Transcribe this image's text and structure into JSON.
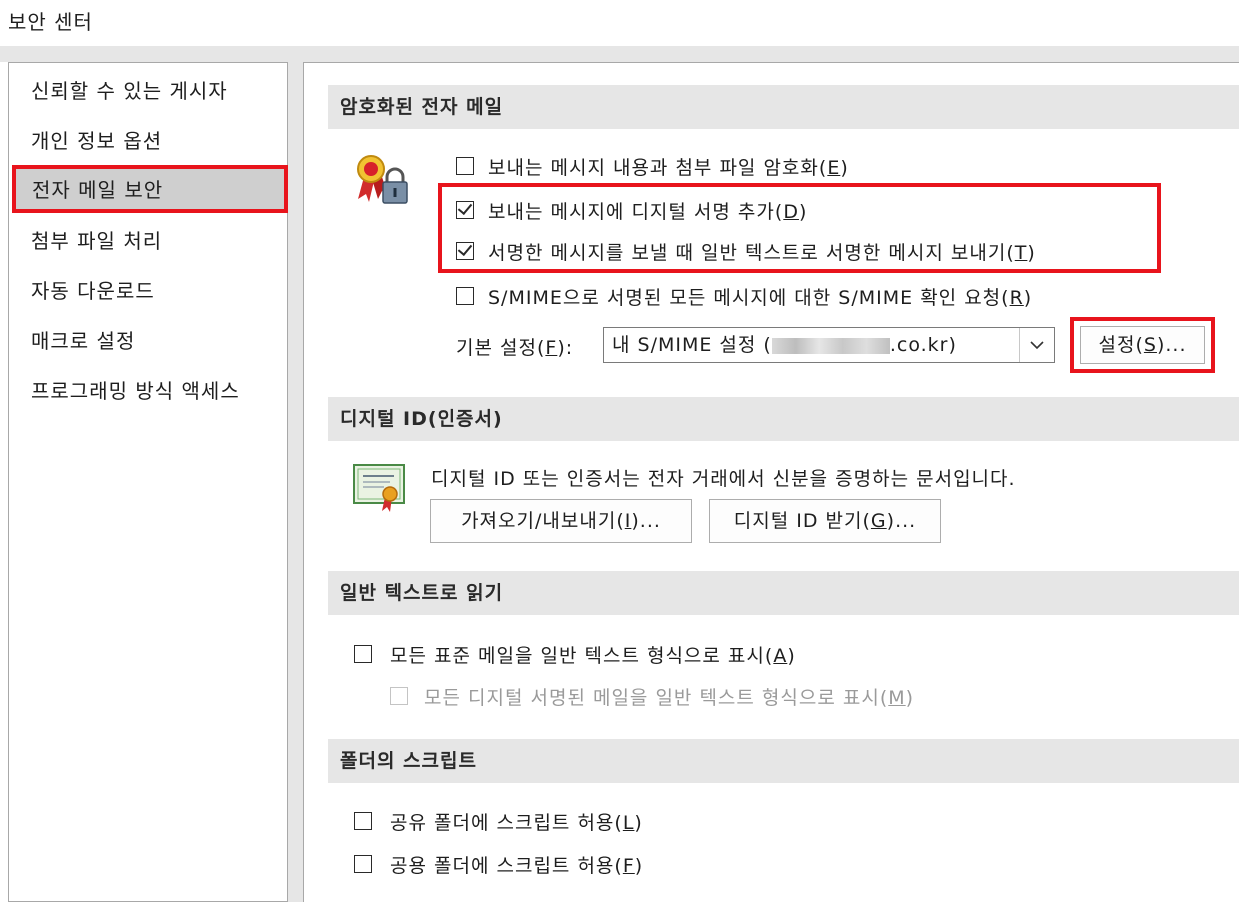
{
  "window": {
    "title": "보안 센터"
  },
  "sidebar": {
    "items": [
      {
        "label": "신뢰할 수 있는 게시자"
      },
      {
        "label": "개인 정보 옵션"
      },
      {
        "label": "전자 메일 보안"
      },
      {
        "label": "첨부 파일 처리"
      },
      {
        "label": "자동 다운로드"
      },
      {
        "label": "매크로 설정"
      },
      {
        "label": "프로그래밍 방식 액세스"
      }
    ],
    "selected_index": 2
  },
  "encrypted_email": {
    "header": "암호화된 전자 메일",
    "options": [
      {
        "label": "보내는 메시지 내용과 첨부 파일 암호화",
        "accel": "E",
        "checked": false
      },
      {
        "label": "보내는 메시지에 디지털 서명 추가",
        "accel": "D",
        "checked": true
      },
      {
        "label": "서명한 메시지를 보낼 때 일반 텍스트로 서명한 메시지 보내기",
        "accel": "T",
        "checked": true
      },
      {
        "label": "S/MIME으로 서명된 모든 메시지에 대한 S/MIME 확인 요청",
        "accel": "R",
        "checked": false
      }
    ],
    "default_setting_label": "기본 설정",
    "default_setting_accel": "F",
    "default_setting_value_prefix": "내 S/MIME 설정 (",
    "default_setting_value_suffix": ".co.kr)",
    "settings_button": {
      "label": "설정",
      "accel": "S",
      "suffix": "..."
    }
  },
  "digital_id": {
    "header": "디지털 ID(인증서)",
    "description": "디지털 ID 또는 인증서는 전자 거래에서 신분을 증명하는 문서입니다.",
    "import_export_button": {
      "label": "가져오기/내보내기",
      "accel": "I",
      "suffix": "..."
    },
    "get_id_button": {
      "label": "디지털 ID 받기",
      "accel": "G",
      "suffix": "..."
    }
  },
  "plain_text": {
    "header": "일반 텍스트로 읽기",
    "options": [
      {
        "label": "모든 표준 메일을 일반 텍스트 형식으로 표시",
        "accel": "A",
        "checked": false,
        "enabled": true
      },
      {
        "label": "모든 디지털 서명된 메일을 일반 텍스트 형식으로 표시",
        "accel": "M",
        "checked": false,
        "enabled": false
      }
    ]
  },
  "folder_scripts": {
    "header": "폴더의 스크립트",
    "options": [
      {
        "label": "공유 폴더에 스크립트 허용",
        "accel": "L",
        "checked": false
      },
      {
        "label": "공용 폴더에 스크립트 허용",
        "accel": "F",
        "checked": false
      }
    ]
  },
  "colors": {
    "highlight_red": "#e8141c",
    "section_bg": "#e6e6e6",
    "selected_bg": "#cfcfcf"
  },
  "icons": {
    "encryption": "certificate-lock-icon",
    "digital_id": "certificate-document-icon",
    "combo_arrow": "chevron-down-icon"
  }
}
